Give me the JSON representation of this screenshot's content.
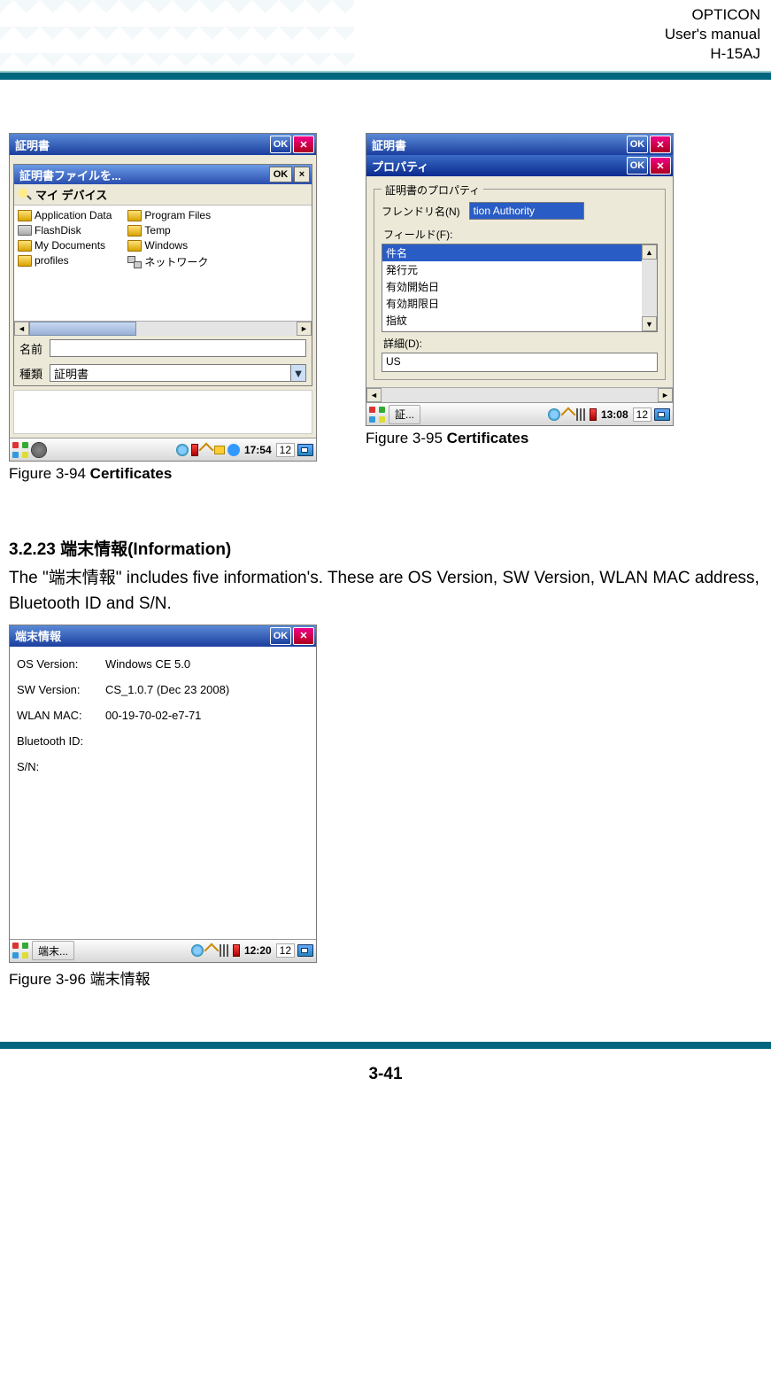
{
  "header": {
    "line1": "OPTICON",
    "line2": "User's manual",
    "line3": "H-15AJ"
  },
  "fig94": {
    "outer_title": "証明書",
    "inner_title": "証明書ファイルを...",
    "ok": "OK",
    "mydevice": "マイ デバイス",
    "files_left": [
      {
        "icon": "folder",
        "label": "Application Data"
      },
      {
        "icon": "disk",
        "label": "FlashDisk"
      },
      {
        "icon": "folder",
        "label": "My Documents"
      },
      {
        "icon": "folder",
        "label": "profiles"
      }
    ],
    "files_right": [
      {
        "icon": "folder",
        "label": "Program Files"
      },
      {
        "icon": "folder",
        "label": "Temp"
      },
      {
        "icon": "folder",
        "label": "Windows"
      },
      {
        "icon": "net",
        "label": "ネットワーク"
      }
    ],
    "name_label": "名前",
    "type_label": "種類",
    "type_value": "証明書",
    "taskbar_time": "17:54",
    "taskbar_date": "12",
    "caption_prefix": "Figure 3-94 ",
    "caption_bold": "Certificates"
  },
  "fig95": {
    "outer_title": "証明書",
    "props_title": "プロパティ",
    "ok": "OK",
    "group_legend": "証明書のプロパティ",
    "friendly_label": "フレンドリ名(N)",
    "friendly_value": "tion Authority",
    "field_label": "フィールド(F):",
    "fields": [
      "件名",
      "発行元",
      "有効開始日",
      "有効期限日",
      "指紋"
    ],
    "detail_label": "詳細(D):",
    "detail_value": "US",
    "task_app": "証...",
    "taskbar_time": "13:08",
    "taskbar_date": "12",
    "caption_prefix": "Figure 3-95 ",
    "caption_bold": "Certificates"
  },
  "section": {
    "heading": "3.2.23  端末情報(Information)",
    "body": "The \"端末情報\" includes five information's. These are OS Version, SW Version, WLAN MAC address, Bluetooth ID and S/N."
  },
  "fig96": {
    "title": "端末情報",
    "ok": "OK",
    "rows": [
      {
        "k": "OS Version:",
        "v": "Windows CE 5.0"
      },
      {
        "k": "SW Version:",
        "v": "CS_1.0.7 (Dec 23 2008)"
      },
      {
        "k": "WLAN MAC:",
        "v": "00-19-70-02-e7-71"
      },
      {
        "k": "Bluetooth ID:",
        "v": ""
      },
      {
        "k": "S/N:",
        "v": ""
      }
    ],
    "task_app": "端末...",
    "taskbar_time": "12:20",
    "taskbar_date": "12",
    "caption": "Figure 3-96 端末情報"
  },
  "footer": {
    "page": "3-41"
  }
}
